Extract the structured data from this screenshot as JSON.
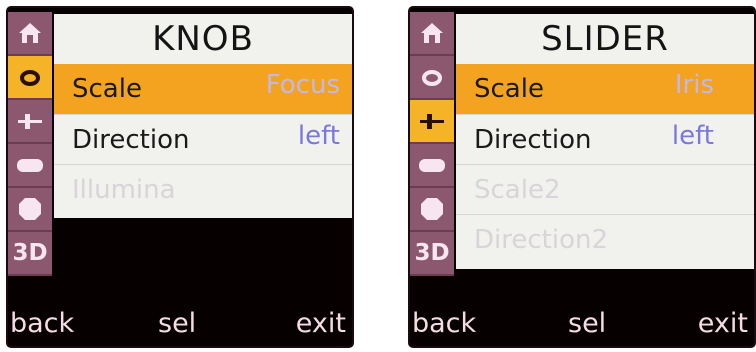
{
  "screens": [
    {
      "title": "KNOB",
      "sidebar": [
        {
          "icon": "home-icon",
          "active": false
        },
        {
          "icon": "ring-icon",
          "active": true
        },
        {
          "icon": "slider-icon",
          "active": false
        },
        {
          "icon": "pill-icon",
          "active": false
        },
        {
          "icon": "octagon-icon",
          "active": false
        },
        {
          "icon": "3d-icon",
          "label": "3D",
          "active": false
        }
      ],
      "rows": [
        {
          "label": "Scale",
          "value": "Focus",
          "selected": true,
          "disabled": false
        },
        {
          "label": "Direction",
          "value": "left",
          "selected": false,
          "disabled": false
        },
        {
          "label": "Illumina",
          "value": "",
          "selected": false,
          "disabled": true
        }
      ],
      "softkeys": {
        "left": "back",
        "center": "sel",
        "right": "exit"
      }
    },
    {
      "title": "SLIDER",
      "sidebar": [
        {
          "icon": "home-icon",
          "active": false
        },
        {
          "icon": "ring-icon",
          "active": false
        },
        {
          "icon": "slider-icon",
          "active": true
        },
        {
          "icon": "pill-icon",
          "active": false
        },
        {
          "icon": "octagon-icon",
          "active": false
        },
        {
          "icon": "3d-icon",
          "label": "3D",
          "active": false
        }
      ],
      "rows": [
        {
          "label": "Scale",
          "value": "Iris",
          "selected": true,
          "disabled": false
        },
        {
          "label": "Direction",
          "value": "left",
          "selected": false,
          "disabled": false
        },
        {
          "label": "Scale2",
          "value": "",
          "selected": false,
          "disabled": true
        },
        {
          "label": "Direction2",
          "value": "",
          "selected": false,
          "disabled": true
        }
      ],
      "softkeys": {
        "left": "back",
        "center": "sel",
        "right": "exit"
      }
    }
  ],
  "colors": {
    "sidebar": "#8c5870",
    "highlight": "#f3a320",
    "panel": "#f1f1ee",
    "value": "#7b78d8",
    "screen_bg": "#070000"
  }
}
